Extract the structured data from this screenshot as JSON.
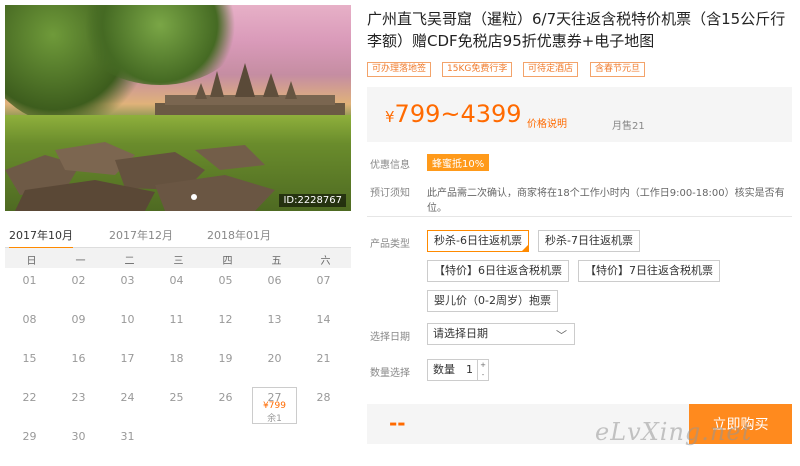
{
  "hero": {
    "image_id": "ID:2228767"
  },
  "calendar": {
    "tabs": [
      "2017年10月",
      "2017年12月",
      "2018年01月"
    ],
    "weekdays": [
      "日",
      "一",
      "二",
      "三",
      "四",
      "五",
      "六"
    ],
    "days": [
      [
        "01",
        "02",
        "03",
        "04",
        "05",
        "06",
        "07"
      ],
      [
        "08",
        "09",
        "10",
        "11",
        "12",
        "13",
        "14"
      ],
      [
        "15",
        "16",
        "17",
        "18",
        "19",
        "20",
        "21"
      ],
      [
        "22",
        "23",
        "24",
        "25",
        "26",
        "27",
        "28"
      ],
      [
        "29",
        "30",
        "31"
      ]
    ],
    "selected": {
      "day": "27",
      "price": "¥799",
      "stock": "余1"
    }
  },
  "product": {
    "title": "广州直飞吴哥窟（暹粒）6/7天往返含税特价机票（含15公斤行李额）赠CDF免税店95折优惠券+电子地图",
    "tags": [
      "可办理落地签",
      "15KG免费行李",
      "可待定酒店",
      "含春节元旦"
    ],
    "price_symbol": "¥",
    "price_range": "799~4399",
    "price_note": "价格说明",
    "monthly_sales": "月售21"
  },
  "info": {
    "promo_label": "优惠信息",
    "promo_badge": "蜂蜜抵10%",
    "notice_label": "预订须知",
    "notice_text": "此产品需二次确认，商家将在18个工作小时内（工作日9:00-18:00）核实是否有位。"
  },
  "options": {
    "type_label": "产品类型",
    "types": [
      "秒杀-6日往返机票",
      "秒杀-7日往返机票",
      "【特价】6日往返含税机票",
      "【特价】7日往返含税机票",
      "婴儿价（0-2周岁）抱票"
    ],
    "selected_index": 0,
    "date_label": "选择日期",
    "date_placeholder": "请选择日期",
    "qty_label": "数量选择",
    "qty_prefix": "数量",
    "qty_value": "1"
  },
  "buy": {
    "total": "--",
    "button_label": "立即购买"
  },
  "watermark": "eLvXing.net",
  "colors": {
    "accent": "#ff8a1e",
    "price": "#ff6a00",
    "tag_border": "#f3a36a"
  }
}
